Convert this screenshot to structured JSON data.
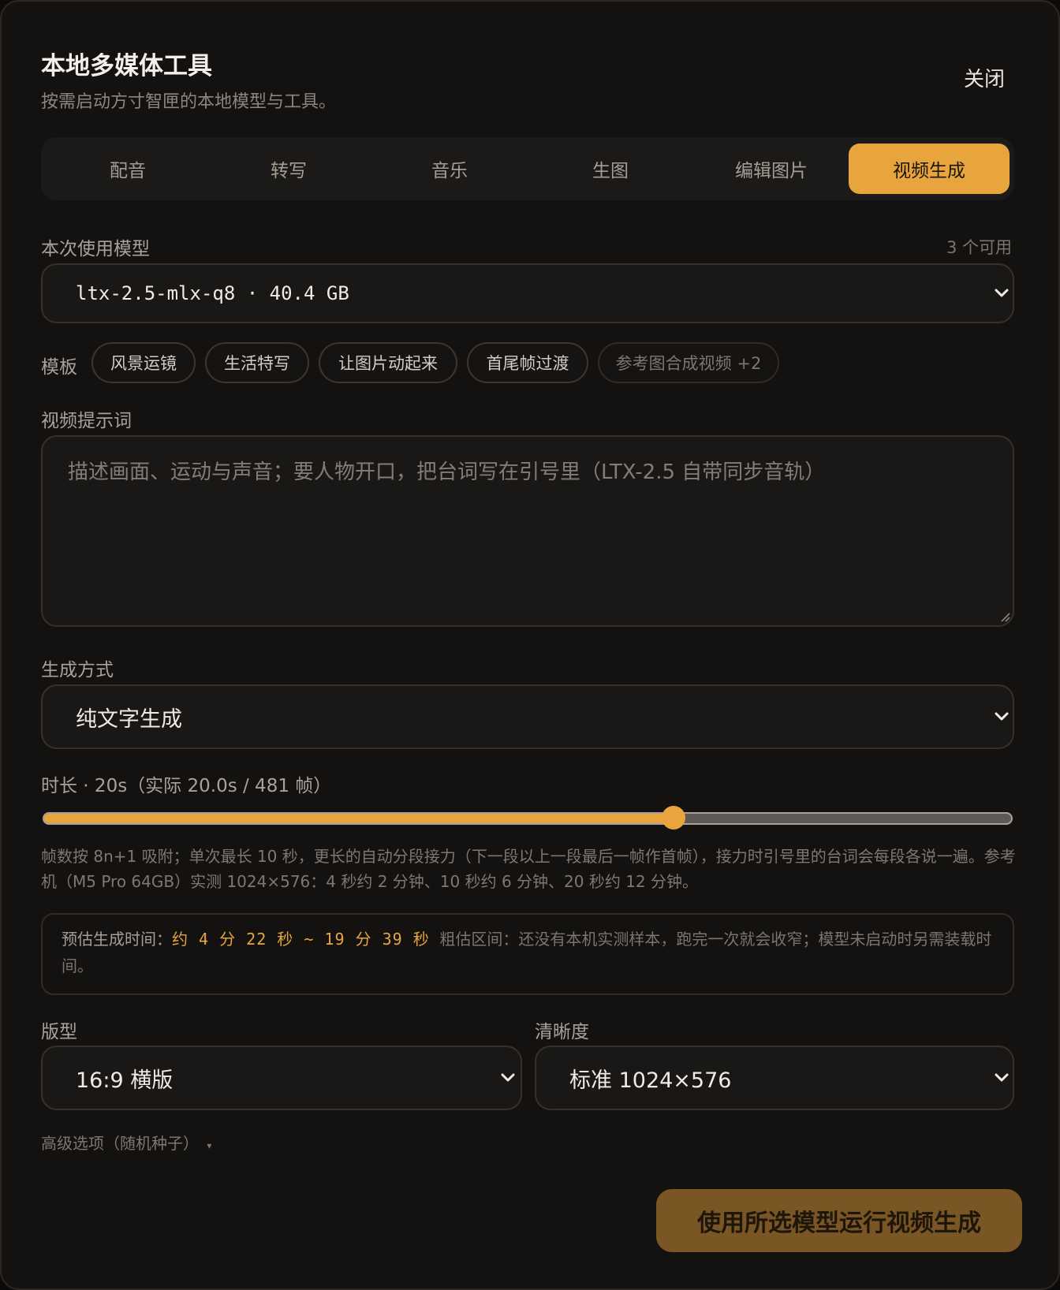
{
  "header": {
    "title": "本地多媒体工具",
    "subtitle": "按需启动方寸智匣的本地模型与工具。",
    "close_label": "关闭"
  },
  "tabs": [
    {
      "label": "配音",
      "active": false
    },
    {
      "label": "转写",
      "active": false
    },
    {
      "label": "音乐",
      "active": false
    },
    {
      "label": "生图",
      "active": false
    },
    {
      "label": "编辑图片",
      "active": false
    },
    {
      "label": "视频生成",
      "active": true
    }
  ],
  "model": {
    "label": "本次使用模型",
    "available": "3 个可用",
    "selected": "ltx-2.5-mlx-q8 · 40.4 GB"
  },
  "templates": {
    "label": "模板",
    "items": [
      "风景运镜",
      "生活特写",
      "让图片动起来",
      "首尾帧过渡",
      "参考图合成视频 +2"
    ]
  },
  "prompt": {
    "label": "视频提示词",
    "placeholder": "描述画面、运动与声音；要人物开口，把台词写在引号里（LTX-2.5 自带同步音轨）"
  },
  "mode": {
    "label": "生成方式",
    "selected": "纯文字生成"
  },
  "duration": {
    "label": "时长 · 20s（实际 20.0s / 481 帧）",
    "fraction": 0.65
  },
  "hint": "帧数按 8n+1 吸附；单次最长 10 秒，更长的自动分段接力（下一段以上一段最后一帧作首帧），接力时引号里的台词会每段各说一遍。参考机（M5 Pro 64GB）实测 1024×576：4 秒约 2 分钟、10 秒约 6 分钟、20 秒约 12 分钟。",
  "estimate": {
    "label": "预估生成时间：",
    "value": "约 4 分 22 秒 ~ 19 分 39 秒",
    "note": "粗估区间：还没有本机实测样本，跑完一次就会收窄；模型未启动时另需装载时间。"
  },
  "layout_select": {
    "label": "版型",
    "selected": "16:9 横版"
  },
  "quality_select": {
    "label": "清晰度",
    "selected": "标准 1024×576"
  },
  "advanced": {
    "label": "高级选项（随机种子）",
    "arrow": "▾"
  },
  "run_button": "使用所选模型运行视频生成",
  "colors": {
    "accent": "#e9a53d",
    "background": "#131211",
    "run_button_bg": "#7a5624"
  }
}
